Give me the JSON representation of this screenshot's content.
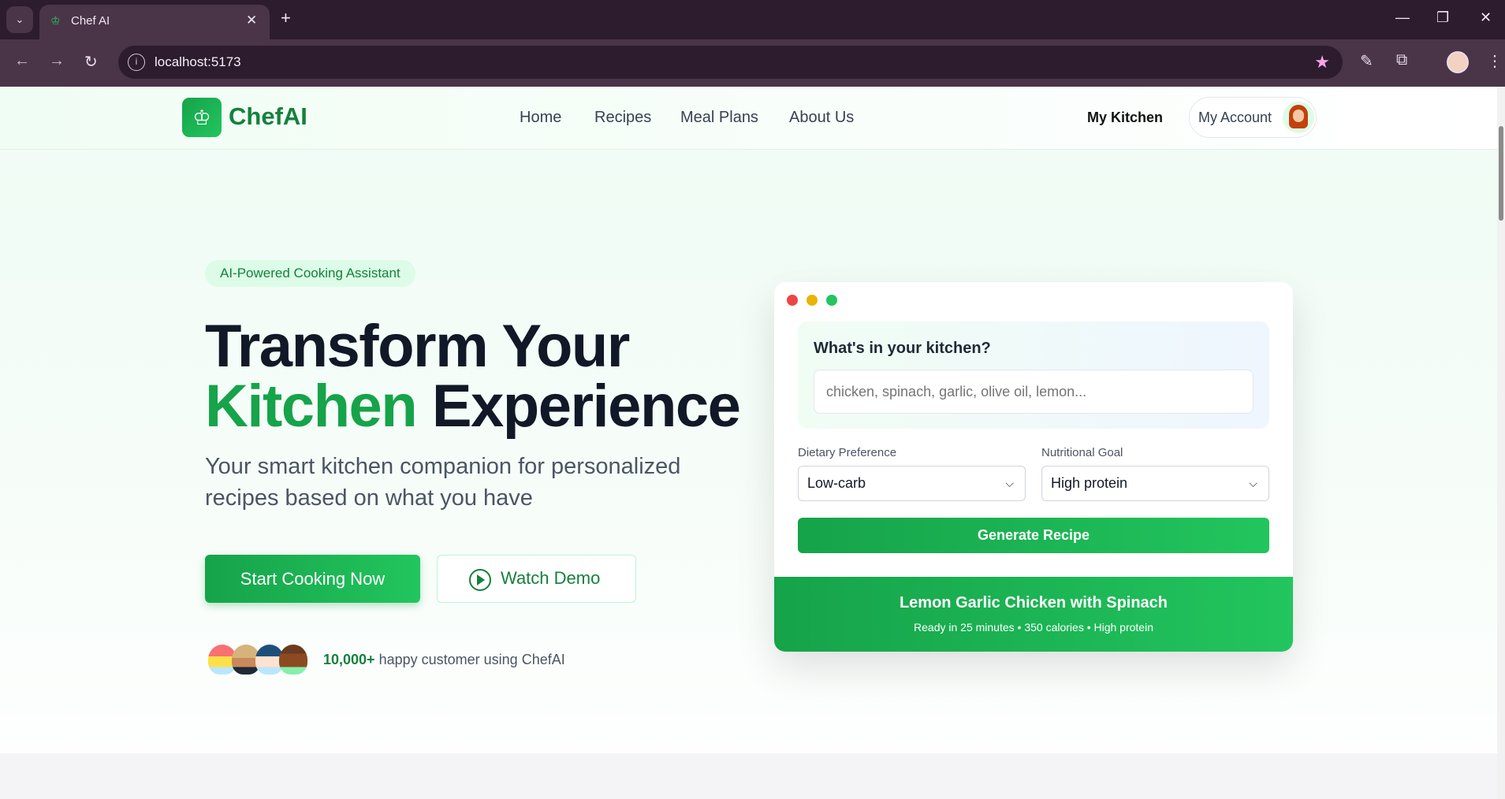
{
  "browser": {
    "tab_title": "Chef AI",
    "url": "localhost:5173"
  },
  "nav": {
    "logo": "ChefAI",
    "links": [
      "Home",
      "Recipes",
      "Meal Plans",
      "About Us"
    ],
    "my_kitchen": "My Kitchen",
    "my_account": "My Account"
  },
  "hero": {
    "badge": "AI-Powered Cooking Assistant",
    "title_line1": "Transform Your",
    "title_highlight": "Kitchen",
    "title_rest": "Experience",
    "subtitle_line1": "Your smart kitchen companion for personalized",
    "subtitle_line2": "recipes based on what you have",
    "start_button": "Start Cooking Now",
    "demo_button": "Watch Demo",
    "social_count": "10,000+",
    "social_text": "happy customer using ChefAI"
  },
  "card": {
    "question": "What's in your kitchen?",
    "ingredients_placeholder": "chicken, spinach, garlic, olive oil, lemon...",
    "dietary_label": "Dietary Preference",
    "dietary_value": "Low-carb",
    "goal_label": "Nutritional Goal",
    "goal_value": "High protein",
    "generate_button": "Generate Recipe",
    "result_title": "Lemon Garlic Chicken with Spinach",
    "result_meta": "Ready in 25 minutes • 350 calories • High protein"
  },
  "colors": {
    "brand": "#16a34a",
    "brand_light": "#22c55e",
    "chrome": "#2d1b2e"
  }
}
